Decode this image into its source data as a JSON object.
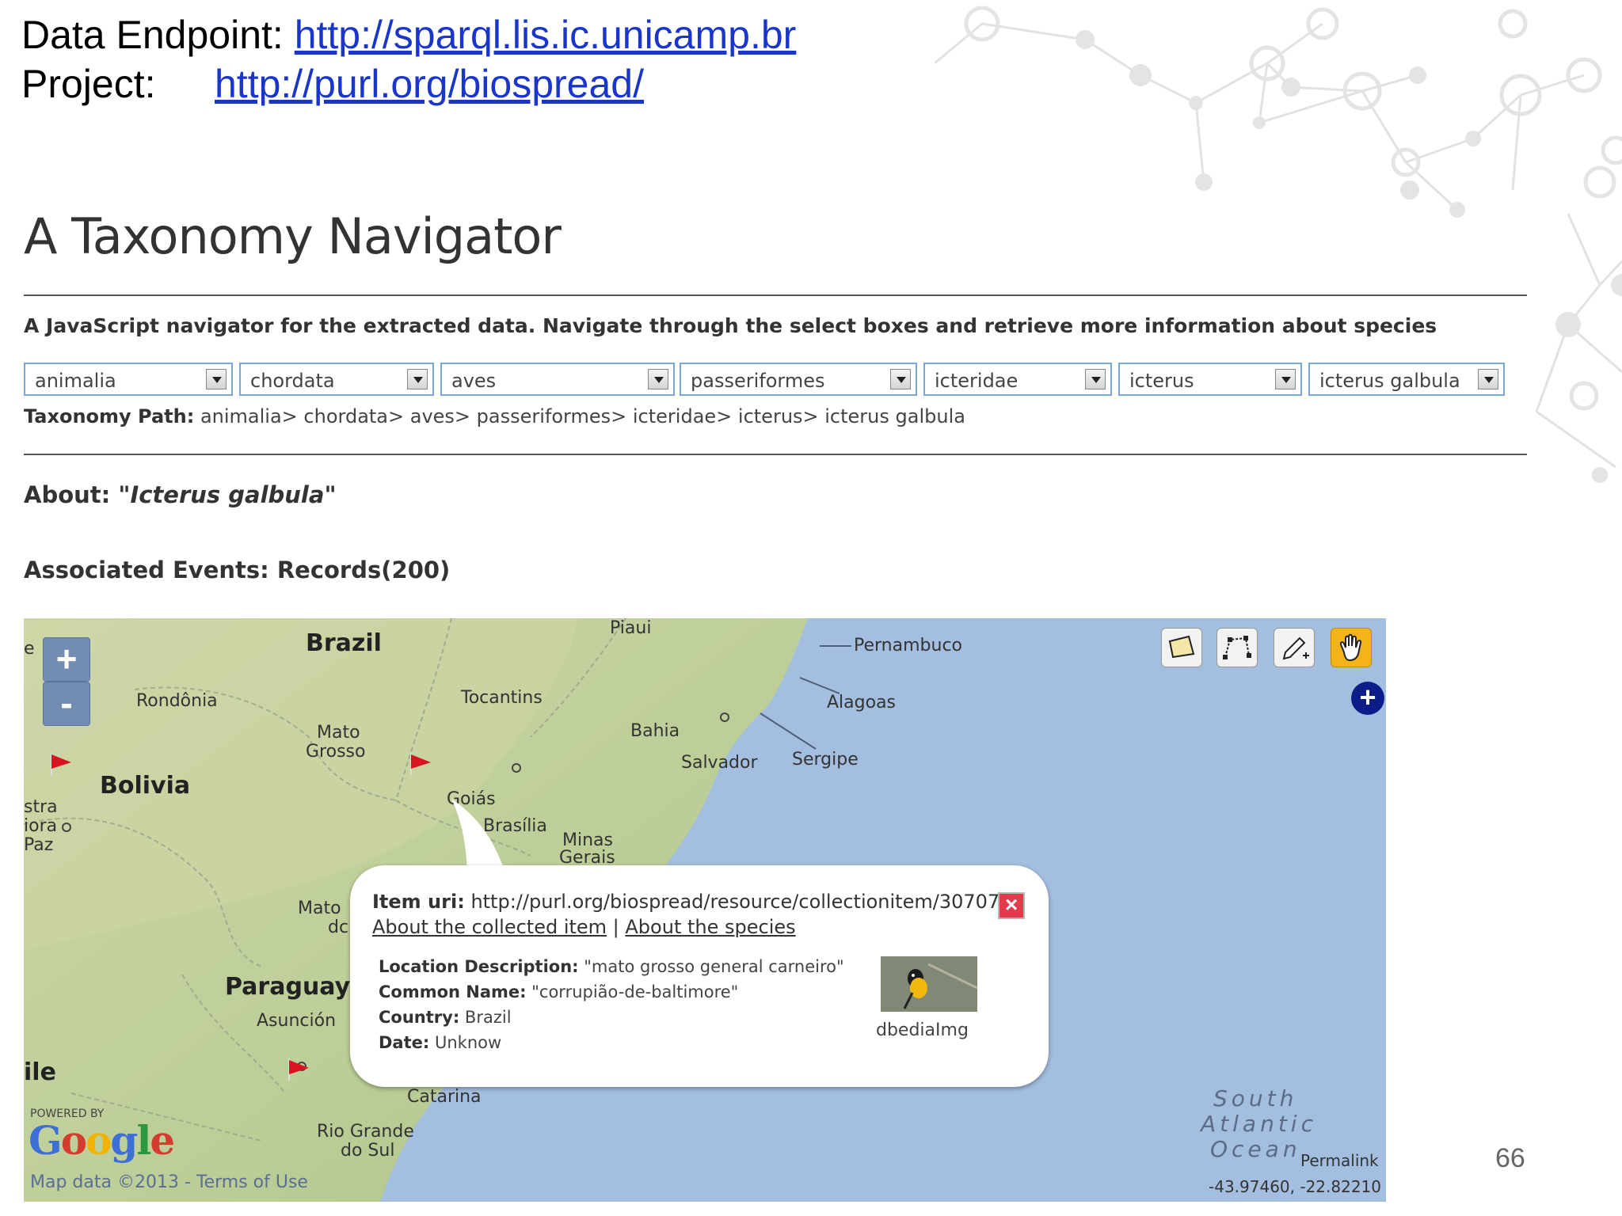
{
  "header": {
    "endpoint_label": "Data Endpoint:",
    "endpoint_url": "http://sparql.lis.ic.unicamp.br",
    "project_label": "Project:",
    "project_url": "http://purl.org/biospread/"
  },
  "page_title": "A Taxonomy Navigator",
  "description": "A JavaScript navigator for the extracted data. Navigate through the select boxes and retrieve more information about species",
  "selects": [
    "animalia",
    "chordata",
    "aves",
    "passeriformes",
    "icteridae",
    "icterus",
    "icterus galbula"
  ],
  "taxonomy_path": {
    "label": "Taxonomy Path:",
    "value": "animalia> chordata> aves> passeriformes> icteridae> icterus> icterus galbula"
  },
  "about": {
    "prefix": "About: \"",
    "species": "Icterus galbula",
    "suffix": "\""
  },
  "associated_events": "Associated Events: Records(200)",
  "map": {
    "zoom_in": "+",
    "zoom_out": "-",
    "layer_switcher": "+",
    "labels": {
      "brazil": "Brazil",
      "bolivia": "Bolivia",
      "paraguay": "Paraguay",
      "rondonia": "Rondônia",
      "mato_grosso_1": "Mato",
      "mato_grosso_2": "Grosso",
      "tocantins": "Tocantins",
      "piaui": "Piaui",
      "pernambuco": "Pernambuco",
      "alagoas": "Alagoas",
      "bahia": "Bahia",
      "salvador": "Salvador",
      "sergipe": "Sergipe",
      "goias": "Goiás",
      "brasilia": "Brasília",
      "minas_1": "Minas",
      "minas_2": "Gerais",
      "stra": "stra",
      "iora": "iora",
      "paz": "Paz",
      "mato_do_1": "Mato",
      "mato_do_2": "dc",
      "asuncion": "Asunción",
      "ile": "ile",
      "catarina": "Catarina",
      "rio_grande_1": "Rio Grande",
      "rio_grande_2": "do Sul",
      "ocean_1": "South",
      "ocean_2": "Atlantic",
      "ocean_3": "Ocean",
      "edge_e": "e"
    },
    "popup": {
      "uri_label": "Item uri:",
      "uri_value": "http://purl.org/biospread/resource/collectionitem/30707",
      "link_item": "About the collected item",
      "link_separator": " | ",
      "link_species": "About the species",
      "location_label": "Location Description:",
      "location_value": "\"mato grosso general carneiro\"",
      "common_label": "Common Name:",
      "common_value": "\"corrupião-de-baltimore\"",
      "country_label": "Country:",
      "country_value": "Brazil",
      "date_label": "Date:",
      "date_value": "Unknow",
      "image_label": "dbediaImg",
      "close": "×"
    },
    "powered_by": "POWERED BY",
    "google": [
      "G",
      "o",
      "o",
      "g",
      "l",
      "e"
    ],
    "map_data": "Map data ©2013 - Terms of Use",
    "permalink": "Permalink",
    "coords": "-43.97460, -22.82210"
  },
  "page_number": "66"
}
